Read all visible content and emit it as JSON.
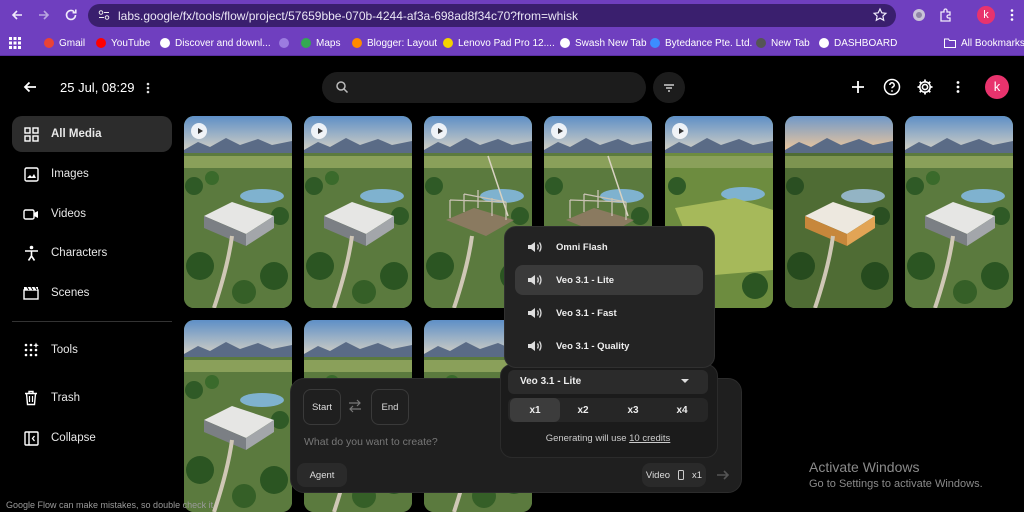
{
  "browser": {
    "url": "labs.google/fx/tools/flow/project/57659bbe-070b-4244-af3a-698ad8f34c70?from=whisk",
    "profile_initial": "k",
    "bookmarks": [
      {
        "label": "Gmail",
        "color": "#ea4335"
      },
      {
        "label": "YouTube",
        "color": "#ff0000"
      },
      {
        "label": "Discover and downl...",
        "color": "#ffffff"
      },
      {
        "label": "",
        "color": "#9c7ce0"
      },
      {
        "label": "Maps",
        "color": "#34a853"
      },
      {
        "label": "Blogger: Layout",
        "color": "#ff8a00"
      },
      {
        "label": "Lenovo Pad Pro 12....",
        "color": "#f4d300"
      },
      {
        "label": "Swash New Tab",
        "color": "#ffffff"
      },
      {
        "label": "Bytedance Pte. Ltd.",
        "color": "#3c8dff"
      },
      {
        "label": "New Tab",
        "color": "#555555"
      },
      {
        "label": "DASHBOARD",
        "color": "#ffffff"
      }
    ],
    "all_bookmarks_label": "All Bookmarks"
  },
  "header": {
    "project_title": "25 Jul, 08:29",
    "avatar_initial": "k",
    "avatar_color": "#e8336d"
  },
  "sidebar": {
    "items": [
      {
        "label": "All Media",
        "icon": "grid-icon"
      },
      {
        "label": "Images",
        "icon": "image-icon"
      },
      {
        "label": "Videos",
        "icon": "video-icon"
      },
      {
        "label": "Characters",
        "icon": "person-icon"
      },
      {
        "label": "Scenes",
        "icon": "clapper-icon"
      },
      {
        "label": "Tools",
        "icon": "sparkle-grid-icon"
      },
      {
        "label": "Trash",
        "icon": "trash-icon"
      },
      {
        "label": "Collapse",
        "icon": "collapse-icon"
      }
    ]
  },
  "model_menu": {
    "options": [
      {
        "label": "Omni Flash",
        "selected": false
      },
      {
        "label": "Veo 3.1 - Lite",
        "selected": true
      },
      {
        "label": "Veo 3.1 - Fast",
        "selected": false
      },
      {
        "label": "Veo 3.1 - Quality",
        "selected": false
      }
    ]
  },
  "settings": {
    "selected_model": "Veo 3.1 - Lite",
    "multipliers": [
      "x1",
      "x2",
      "x3",
      "x4"
    ],
    "selected_multiplier": "x1",
    "credits_prefix": "Generating will use",
    "credits_link": "10 credits"
  },
  "composer": {
    "start_label": "Start",
    "end_label": "End",
    "placeholder": "What do you want to create?",
    "agent_label": "Agent",
    "mode_label": "Video",
    "count_label": "x1"
  },
  "footer": {
    "disclaimer": "Google Flow can make mistakes, so double check it"
  },
  "watermark": {
    "title": "Activate Windows",
    "subtitle": "Go to Settings to activate Windows."
  }
}
